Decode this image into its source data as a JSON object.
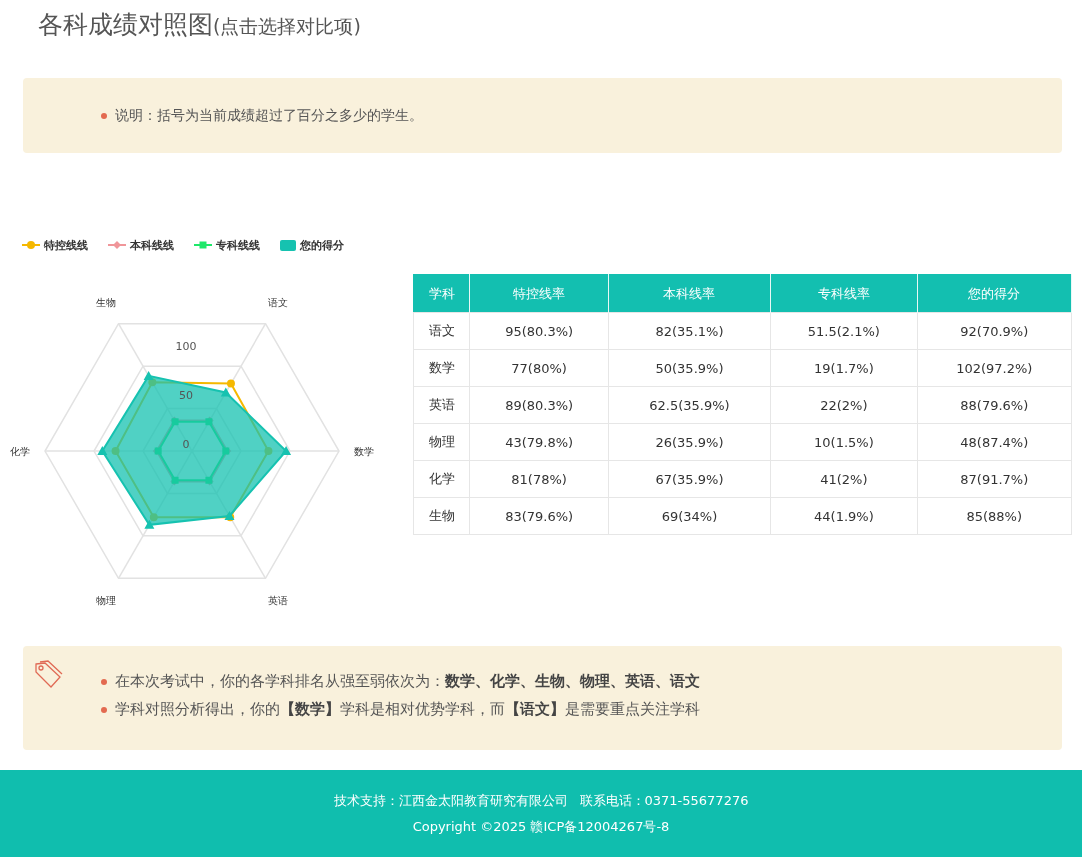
{
  "title": {
    "main": "各科成绩对照图",
    "sub": "(点击选择对比项)"
  },
  "note": {
    "text": "说明：括号为当前成绩超过了百分之多少的学生。"
  },
  "chart": {
    "legend": [
      {
        "name": "特控线线",
        "color": "#f5b800",
        "kind": "circleline"
      },
      {
        "name": "本科线线",
        "color": "#f0969a",
        "kind": "diamondline"
      },
      {
        "name": "专科线线",
        "color": "#1ee86a",
        "kind": "squareline"
      },
      {
        "name": "您的得分",
        "color": "#16c2b0",
        "kind": "area"
      }
    ],
    "axis_labels": [
      "语文",
      "数学",
      "英语",
      "物理",
      "化学",
      "生物"
    ],
    "tick_labels": [
      "100",
      "50",
      "0"
    ]
  },
  "table": {
    "columns": [
      "学科",
      "特控线率",
      "本科线率",
      "专科线率",
      "您的得分"
    ],
    "rows": [
      [
        "语文",
        "95(80.3%)",
        "82(35.1%)",
        "51.5(2.1%)",
        "92(70.9%)"
      ],
      [
        "数学",
        "77(80%)",
        "50(35.9%)",
        "19(1.7%)",
        "102(97.2%)"
      ],
      [
        "英语",
        "89(80.3%)",
        "62.5(35.9%)",
        "22(2%)",
        "88(79.6%)"
      ],
      [
        "物理",
        "43(79.8%)",
        "26(35.9%)",
        "10(1.5%)",
        "48(87.4%)"
      ],
      [
        "化学",
        "81(78%)",
        "67(35.9%)",
        "41(2%)",
        "87(91.7%)"
      ],
      [
        "生物",
        "83(79.6%)",
        "69(34%)",
        "44(1.9%)",
        "85(88%)"
      ]
    ]
  },
  "summary": {
    "items": [
      "在本次考试中，你的各学科排名从强至弱依次为：**数学、化学、生物、物理、英语、语文**",
      "学科对照分析得出，你的**【数学】**学科是相对优势学科，而**【语文】**是需要重点关注学科"
    ]
  },
  "footer": {
    "support": "技术支持：江西金太阳教育研究有限公司",
    "phone": "联系电话：0371-55677276",
    "copyright": "Copyright ©2025 赣ICP备12004267号-8"
  }
}
